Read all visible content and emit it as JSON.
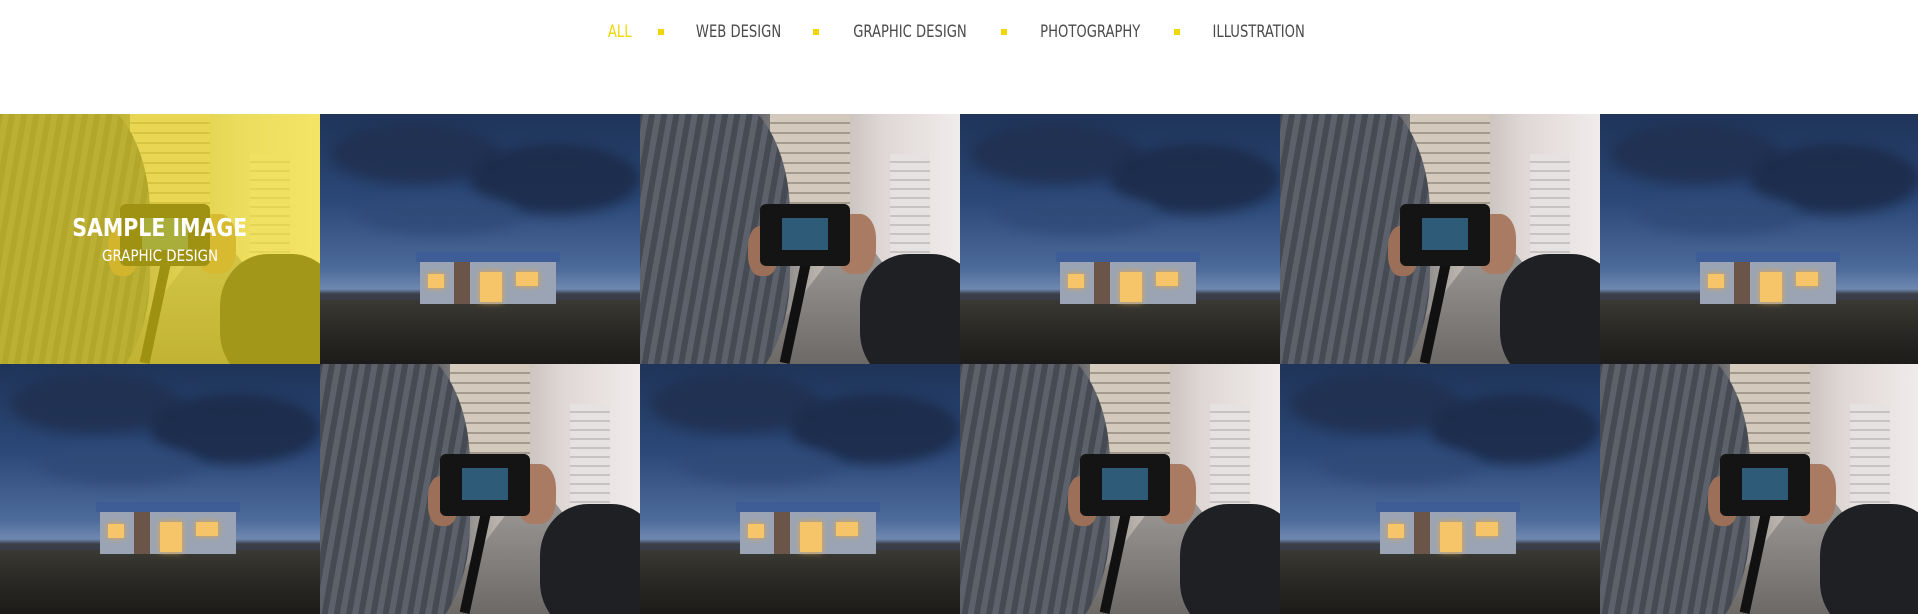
{
  "filters": [
    {
      "label": "ALL",
      "active": true
    },
    {
      "label": "WEB DESIGN",
      "active": false
    },
    {
      "label": "GRAPHIC DESIGN",
      "active": false
    },
    {
      "label": "PHOTOGRAPHY",
      "active": false
    },
    {
      "label": "ILLUSTRATION",
      "active": false
    }
  ],
  "colors": {
    "accent": "#f1d600",
    "text": "#4a4a4a",
    "background": "#ffffff"
  },
  "portfolio": {
    "hovered_item": {
      "title": "SAMPLE IMAGE",
      "category": "GRAPHIC DESIGN"
    },
    "items": [
      {
        "scene": "camera"
      },
      {
        "scene": "house"
      },
      {
        "scene": "camera"
      },
      {
        "scene": "house"
      },
      {
        "scene": "camera"
      },
      {
        "scene": "house"
      },
      {
        "scene": "house"
      },
      {
        "scene": "camera"
      },
      {
        "scene": "house"
      },
      {
        "scene": "camera"
      },
      {
        "scene": "house"
      },
      {
        "scene": "camera"
      }
    ]
  }
}
